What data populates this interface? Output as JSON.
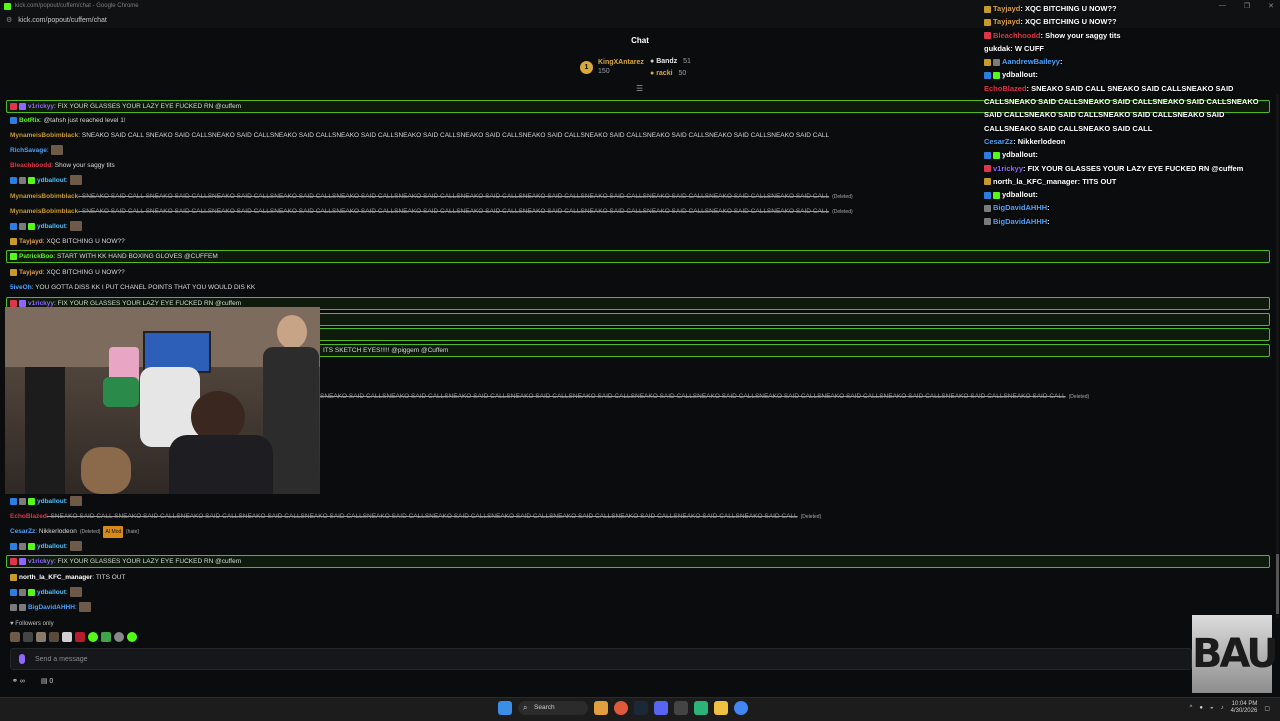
{
  "browser": {
    "title": "kick.com/popout/cuffem/chat - Google Chrome",
    "url": "kick.com/popout/cuffem/chat",
    "window_controls": [
      "—",
      "❐",
      "✕"
    ]
  },
  "header": {
    "title": "Chat",
    "leaderboard": [
      {
        "rank": "1",
        "name": "KingXAntarez",
        "value": "150"
      },
      {
        "name": "Bandz",
        "value": "51"
      },
      {
        "name": "racki",
        "value": "50"
      }
    ]
  },
  "chat": {
    "messages": [
      {
        "user": "v1rickyy",
        "text": ": FIX YOUR GLASSES YOUR LAZY EYE FUCKED RN @cuffem",
        "color": "#8f67ff",
        "hl": true
      },
      {
        "user": "BotRix",
        "text": ": @tahsh just reached level 1!",
        "color": "#53fc18"
      },
      {
        "user": "MynameisBobimblack",
        "text": ": SNEAKO SAID CALL SNEAKO SAID CALLSNEAKO SAID CALLSNEAKO SAID CALLSNEAKO SAID CALLSNEAKO SAID CALLSNEAKO SAID CALLSNEAKO SAID CALLSNEAKO SAID CALLSNEAKO SAID CALLSNEAKO SAID CALLSNEAKO SAID CALL",
        "color": "#c89a2a"
      },
      {
        "user": "RichSavage",
        "text": ":",
        "color": "#4aa3ff",
        "emote": true
      },
      {
        "user": "Bleachhoodd",
        "text": ": Show your saggy tits",
        "color": "#e0344a"
      },
      {
        "user": "ydballout",
        "text": ":",
        "color": "#4ac0ff",
        "emote": true
      },
      {
        "user": "MynameisBobimblack",
        "text": ": SNEAKO SAID CALL SNEAKO SAID CALLSNEAKO SAID CALLSNEAKO SAID CALLSNEAKO SAID CALLSNEAKO SAID CALLSNEAKO SAID CALLSNEAKO SAID CALLSNEAKO SAID CALLSNEAKO SAID CALLSNEAKO SAID CALLSNEAKO SAID CALL",
        "color": "#c89a2a",
        "strike": true,
        "deleted": "(Deleted)"
      },
      {
        "user": "MynameisBobimblack",
        "text": ": SNEAKO SAID CALL SNEAKO SAID CALLSNEAKO SAID CALLSNEAKO SAID CALLSNEAKO SAID CALLSNEAKO SAID CALLSNEAKO SAID CALLSNEAKO SAID CALLSNEAKO SAID CALLSNEAKO SAID CALLSNEAKO SAID CALLSNEAKO SAID CALL",
        "color": "#c89a2a",
        "strike": true,
        "deleted": "(Deleted)"
      },
      {
        "user": "ydballout",
        "text": ":",
        "color": "#4ac0ff",
        "emote": true
      },
      {
        "user": "Tayjayd",
        "text": ": XQC BITCHING U NOW??",
        "color": "#e0a040"
      },
      {
        "user": "PatrickBoo",
        "text": ": START WITH KK HAND BOXING GLOVES @CUFFEM",
        "color": "#53fc18",
        "hl": true
      },
      {
        "user": "Tayjayd",
        "text": ": XQC BITCHING U NOW??",
        "color": "#e0a040"
      },
      {
        "user": "5iveOh",
        "text": ": YOU GOTTA DISS KK I PUT CHANEL POINTS THAT YOU WOULD DIS KK",
        "color": "#4aa3ff"
      },
      {
        "user": "v1rickyy",
        "text": ": FIX YOUR GLASSES YOUR LAZY EYE FUCKED RN @cuffem",
        "color": "#8f67ff",
        "hl": true
      },
      {
        "user": "",
        "text": "",
        "color": "#ffffff",
        "hl": true
      },
      {
        "user": "",
        "text": "",
        "color": "#ffffff",
        "hl": true
      },
      {
        "user": "",
        "text": "ITS SKETCH EYES!!!!! @piggem @Cuffem",
        "color": "#ffffff",
        "hl": true
      },
      {
        "user": "",
        "text": "SNEAKO SAID CALLSNEAKO SAID CALLSNEAKO SAID CALLSNEAKO SAID CALLSNEAKO SAID CALLSNEAKO SAID CALLSNEAKO SAID CALLSNEAKO SAID CALLSNEAKO SAID CALLSNEAKO SAID CALLSNEAKO SAID CALLSNEAKO SAID CALL",
        "color": "#ffffff",
        "strike": true,
        "deleted": "(Deleted)"
      },
      {
        "user": "ydballout",
        "text": ":",
        "color": "#4ac0ff",
        "emote": true
      },
      {
        "user": "EchoBlazed",
        "text": ": SNEAKO SAID CALL SNEAKO SAID CALLSNEAKO SAID CALLSNEAKO SAID CALLSNEAKO SAID CALLSNEAKO SAID CALLSNEAKO SAID CALLSNEAKO SAID CALLSNEAKO SAID CALLSNEAKO SAID CALLSNEAKO SAID CALLSNEAKO SAID CALL",
        "color": "#e0344a",
        "strike": true,
        "deleted": "(Deleted)"
      },
      {
        "user": "CesarZz",
        "text": ": Nikkerlodeon",
        "color": "#4aa3ff",
        "deleted": "(Deleted)",
        "mod": "AI Mod",
        "tag": "[hate]"
      },
      {
        "user": "ydballout",
        "text": ":",
        "color": "#4ac0ff",
        "emote": true
      },
      {
        "user": "v1rickyy",
        "text": ": FIX YOUR GLASSES YOUR LAZY EYE FUCKED RN @cuffem",
        "color": "#8f67ff",
        "hl": true
      },
      {
        "user": "north_la_KFC_manager",
        "text": ": TITS OUT",
        "color": "#ffffff"
      },
      {
        "user": "ydballout",
        "text": ":",
        "color": "#4ac0ff",
        "emote": true
      },
      {
        "user": "BigDavidAHHH",
        "text": ":",
        "color": "#4aa3ff",
        "emote": true
      }
    ],
    "followers_only": "Followers only",
    "input_placeholder": "Send a message",
    "stats": {
      "viewers": "∞",
      "gifts": "0"
    }
  },
  "overlay": {
    "messages": [
      {
        "user": "Tayjayd",
        "text": ": XQC BITCHING U NOW??",
        "color": "#e0a040"
      },
      {
        "user": "Tayjayd",
        "text": ": XQC BITCHING U NOW??",
        "color": "#e0a040"
      },
      {
        "user": "Bleachhoodd",
        "text": ": Show your saggy tits",
        "color": "#e0344a"
      },
      {
        "user": "gukdak",
        "text": ": W CUFF",
        "color": "#ffffff"
      },
      {
        "user": "AandrewBaileyy",
        "text": ":",
        "color": "#4aa3ff"
      },
      {
        "user": "ydballout",
        "text": ":",
        "color": "#ffffff"
      },
      {
        "user": "EchoBlazed",
        "text": ": SNEAKO SAID CALL SNEAKO SAID CALLSNEAKO SAID CALLSNEAKO SAID CALLSNEAKO SAID CALLSNEAKO SAID CALLSNEAKO SAID CALLSNEAKO SAID CALLSNEAKO SAID CALLSNEAKO SAID CALLSNEAKO SAID CALLSNEAKO SAID CALL",
        "color": "#e0344a"
      },
      {
        "user": "CesarZz",
        "text": ": Nikkerlodeon",
        "color": "#4aa3ff"
      },
      {
        "user": "ydballout",
        "text": ":",
        "color": "#ffffff"
      },
      {
        "user": "v1rickyy",
        "text": ": FIX YOUR GLASSES YOUR LAZY EYE FUCKED RN @cuffem",
        "color": "#8f67ff"
      },
      {
        "user": "north_la_KFC_manager",
        "text": ": TITS OUT",
        "color": "#ffffff"
      },
      {
        "user": "ydballout",
        "text": ":",
        "color": "#ffffff"
      },
      {
        "user": "BigDavidAHHH",
        "text": ":",
        "color": "#4aa3ff"
      },
      {
        "user": "BigDavidAHHH",
        "text": ":",
        "color": "#4aa3ff"
      }
    ]
  },
  "logo": "BAU",
  "taskbar": {
    "search": "Search",
    "time": "10:04 PM",
    "date": "4/30/2026"
  }
}
